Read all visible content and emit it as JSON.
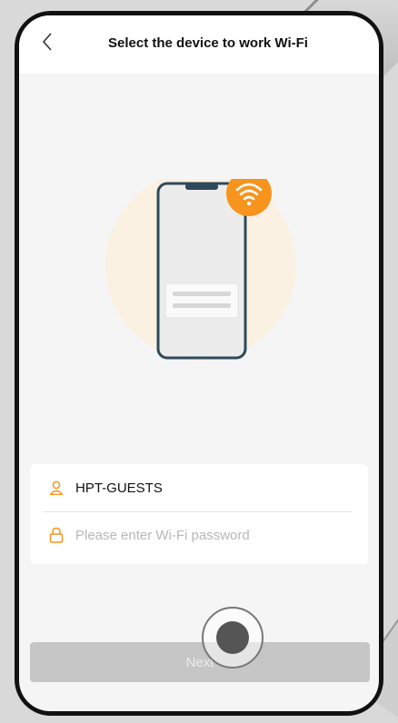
{
  "header": {
    "title": "Select the device to work Wi-Fi"
  },
  "form": {
    "ssid": "HPT-GUESTS",
    "password_placeholder": "Please enter Wi-Fi password",
    "password_value": ""
  },
  "actions": {
    "next_label": "Next"
  },
  "colors": {
    "accent": "#f7941d",
    "button_disabled": "#c6c6c6",
    "halo": "#faf1e3"
  },
  "icons": [
    "back-chevron-icon",
    "wifi-icon",
    "user-icon",
    "lock-icon"
  ]
}
